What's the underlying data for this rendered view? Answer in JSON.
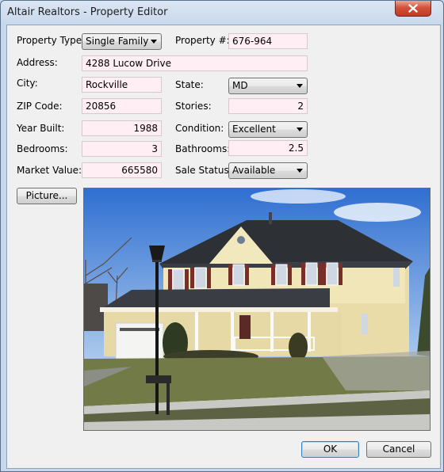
{
  "window": {
    "title": "Altair Realtors - Property Editor"
  },
  "form": {
    "property_type": {
      "label": "Property Type:",
      "value": "Single Family"
    },
    "property_number": {
      "label": "Property #:",
      "value": "676-964"
    },
    "address": {
      "label": "Address:",
      "value": "4288 Lucow Drive"
    },
    "city": {
      "label": "City:",
      "value": "Rockville"
    },
    "state": {
      "label": "State:",
      "value": "MD"
    },
    "zip_code": {
      "label": "ZIP Code:",
      "value": "20856"
    },
    "stories": {
      "label": "Stories:",
      "value": "2"
    },
    "year_built": {
      "label": "Year Built:",
      "value": "1988"
    },
    "condition": {
      "label": "Condition:",
      "value": "Excellent"
    },
    "bedrooms": {
      "label": "Bedrooms:",
      "value": "3"
    },
    "bathrooms": {
      "label": "Bathrooms:",
      "value": "2.5"
    },
    "market_value": {
      "label": "Market Value:",
      "value": "665580"
    },
    "sale_status": {
      "label": "Sale Status:",
      "value": "Available"
    }
  },
  "buttons": {
    "picture": "Picture...",
    "ok": "OK",
    "cancel": "Cancel"
  },
  "icons": {
    "close": "close-icon",
    "dropdown": "chevron-down-icon"
  },
  "colors": {
    "field_background": "#ffeef4",
    "dialog_background": "#f0f0f0",
    "close_button": "#c94a32"
  }
}
